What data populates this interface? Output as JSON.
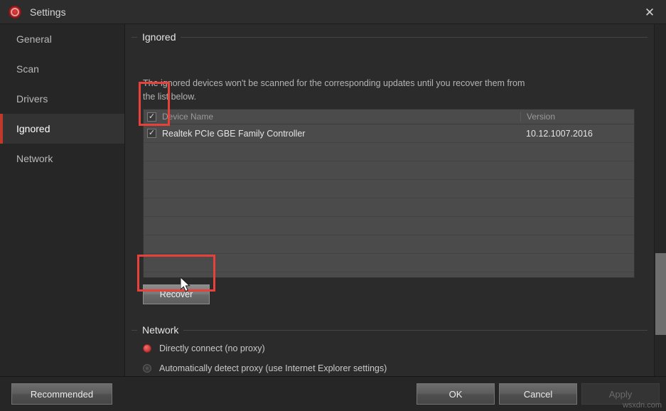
{
  "window": {
    "title": "Settings",
    "app_icon": "settings-app-icon",
    "close_icon": "✕"
  },
  "sidebar": {
    "items": [
      {
        "label": "General",
        "active": false
      },
      {
        "label": "Scan",
        "active": false
      },
      {
        "label": "Drivers",
        "active": false
      },
      {
        "label": "Ignored",
        "active": true
      },
      {
        "label": "Network",
        "active": false
      }
    ]
  },
  "ignored_section": {
    "title": "Ignored",
    "description": "The ignored devices won't be scanned for the corresponding updates until you recover them from the list below.",
    "table": {
      "header_checkbox_checked": true,
      "columns": [
        "Device Name",
        "Version"
      ],
      "rows": [
        {
          "checked": true,
          "device_name": "Realtek PCIe GBE Family Controller",
          "version": "10.12.1007.2016"
        }
      ],
      "empty_row_count": 7
    },
    "recover_button": "Recover"
  },
  "network_section": {
    "title": "Network",
    "options": [
      {
        "label": "Directly connect (no proxy)",
        "selected": true
      },
      {
        "label": "Automatically detect proxy (use Internet Explorer settings)",
        "selected": false
      }
    ]
  },
  "footer": {
    "recommended": "Recommended",
    "ok": "OK",
    "cancel": "Cancel",
    "apply": "Apply"
  },
  "watermark": "wsxdn.com",
  "colors": {
    "accent_red": "#c0392b",
    "annotation_red": "#e8413a",
    "window_bg": "#2b2b2b",
    "sidebar_bg": "#262626",
    "table_bg": "#4b4b4b"
  }
}
